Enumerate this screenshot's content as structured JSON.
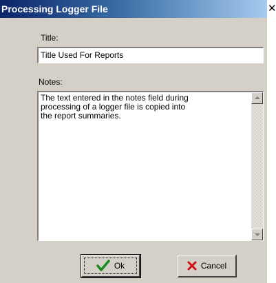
{
  "window": {
    "title": "Processing Logger File",
    "close_symbol": "✕"
  },
  "form": {
    "title_label": "Title:",
    "title_value": "Title Used For Reports",
    "notes_label": "Notes:",
    "notes_value": "The text entered in the notes field during\nprocessing of a logger file is copied into\nthe report summaries."
  },
  "buttons": {
    "ok_label": "Ok",
    "cancel_label": "Cancel"
  },
  "icons": {
    "ok": "check-icon",
    "cancel": "x-icon",
    "close": "close-icon"
  },
  "colors": {
    "title_bar_start": "#0b246a",
    "title_bar_end": "#a6caf0",
    "dialog_face": "#d4d0c8",
    "check_green": "#1a8a1a",
    "cancel_red": "#cc1111"
  }
}
